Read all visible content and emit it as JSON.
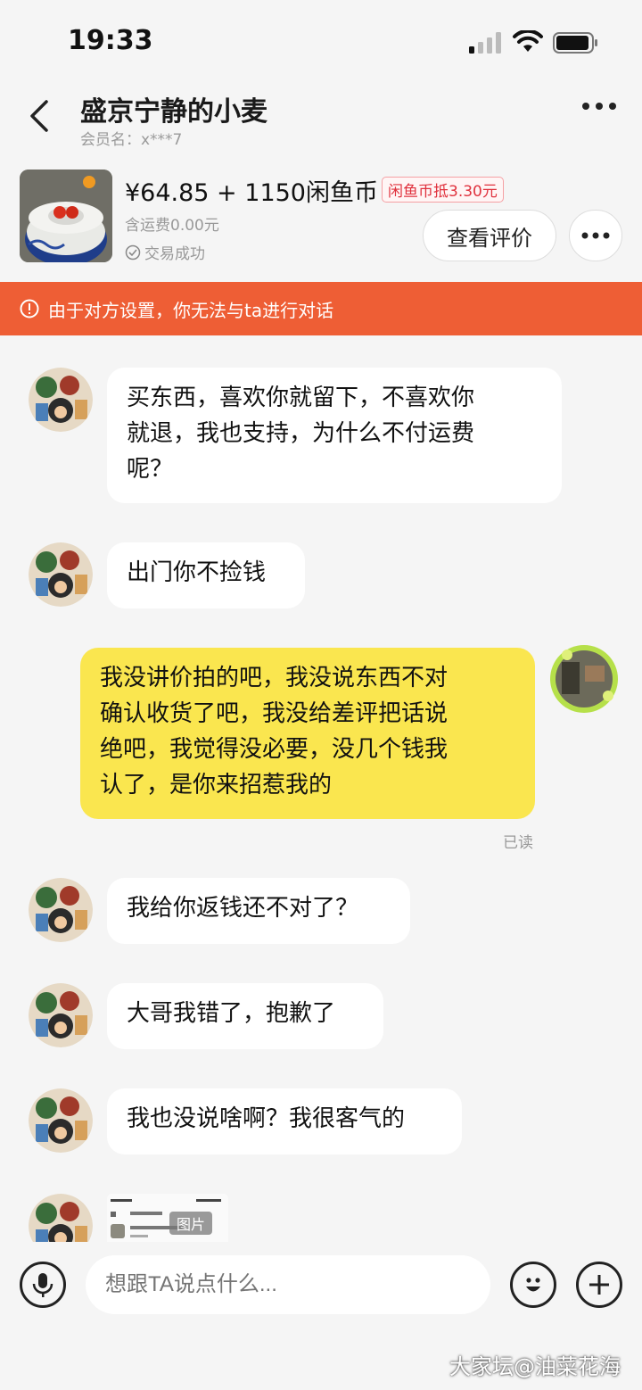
{
  "status": {
    "time": "19:33"
  },
  "header": {
    "title": "盛京宁静的小麦",
    "member": "会员名：x***7"
  },
  "product": {
    "price": "¥64.85 + 1150闲鱼币",
    "coin_badge": "闲鱼币抵3.30元",
    "shipping": "含运费0.00元",
    "deal_status": "交易成功",
    "review_button": "查看评价"
  },
  "notice": "由于对方设置，你无法与ta进行对话",
  "messages": [
    {
      "side": "in",
      "text": "买东西，喜欢你就留下，不喜欢你\n就退，我也支持，为什么不付运费\n呢？"
    },
    {
      "side": "in",
      "text": "出门你不捡钱"
    },
    {
      "side": "out",
      "text": "我没讲价拍的吧，我没说东西不对\n确认收货了吧，我没给差评把话说\n绝吧，我觉得没必要，没几个钱我\n认了，是你来招惹我的"
    },
    {
      "side": "in",
      "text": "我给你返钱还不对了？"
    },
    {
      "side": "in",
      "text": "大哥我错了，抱歉了"
    },
    {
      "side": "in",
      "text": "我也没说啥啊？我很客气的"
    }
  ],
  "read_label": "已读",
  "image_label": "图片",
  "input": {
    "placeholder": "想跟TA说点什么..."
  },
  "watermark": "大家坛@油菜花海",
  "colors": {
    "notice_bg": "#ee5e35",
    "out_bubble": "#fae64f",
    "badge_red": "#e0323e"
  }
}
